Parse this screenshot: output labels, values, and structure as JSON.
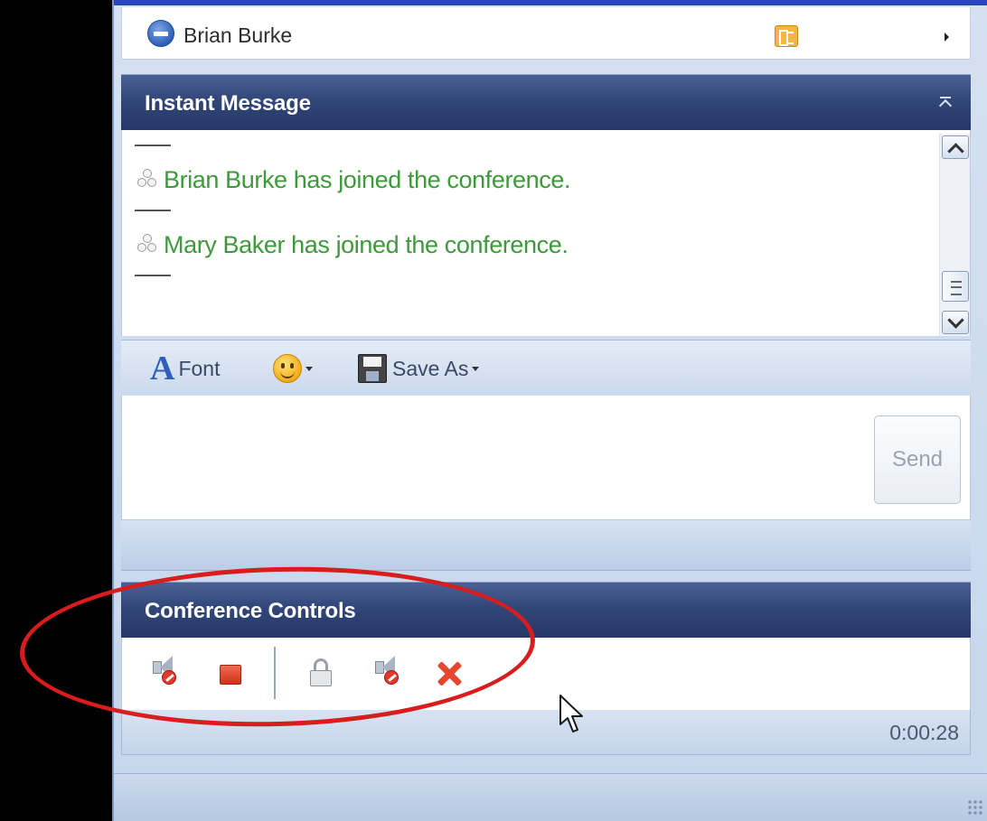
{
  "participant": {
    "name": "Brian Burke"
  },
  "instant_message": {
    "title": "Instant Message",
    "messages": [
      {
        "text": "Brian Burke has joined the conference."
      },
      {
        "text": "Mary Baker has joined the conference."
      }
    ]
  },
  "format_toolbar": {
    "font_glyph": "A",
    "font_label": "Font",
    "save_as_label": "Save As"
  },
  "compose": {
    "send_label": "Send"
  },
  "conference_controls": {
    "title": "Conference Controls",
    "elapsed": "0:00:28"
  },
  "colors": {
    "header_bg": "#324678",
    "system_message": "#3d9a3a",
    "annotation": "#d91c1c"
  },
  "icons": {
    "presence": "presence-busy-icon",
    "contact_card": "contact-card-icon",
    "font": "font-icon",
    "emoticon": "smiley-icon",
    "save": "floppy-disk-icon",
    "mute_audience": "mute-audience-icon",
    "stop": "stop-icon",
    "lock": "lock-icon",
    "mute_all": "mute-all-icon",
    "end": "end-conference-icon"
  }
}
